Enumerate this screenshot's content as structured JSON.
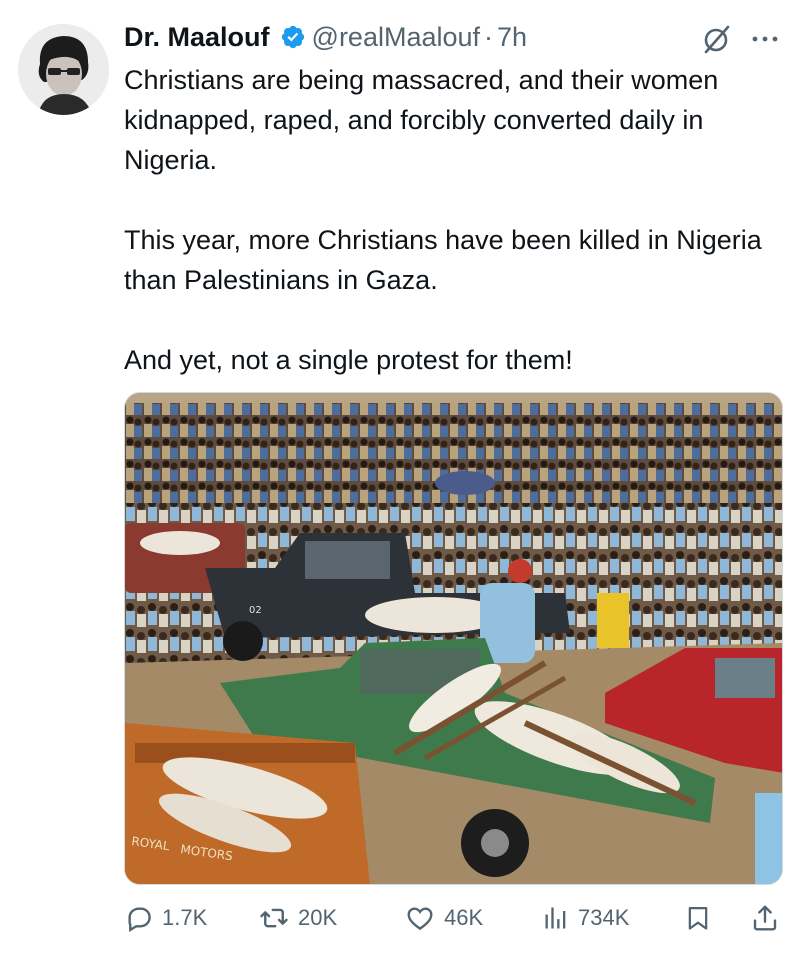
{
  "author": {
    "name": "Dr. Maalouf",
    "handle": "@realMaalouf",
    "separator": "·",
    "time": "7h"
  },
  "icons": {
    "verified": "verified-badge-icon",
    "grok": "grok-icon",
    "more": "more-options-icon"
  },
  "colors": {
    "verified": "#1d9bf0",
    "muted": "#536471",
    "text": "#0f1419"
  },
  "tweet": {
    "paragraphs": [
      "Christians are being massacred, and their women kidnapped, raped, and forcibly converted daily in Nigeria.",
      "This year, more Christians have been killed in Nigeria than Palestinians in Gaza.",
      "And yet, not a single protest for them!"
    ]
  },
  "media": {
    "vehicle_texts": [
      "02",
      "ROYAL",
      "MOTORS"
    ]
  },
  "actions": {
    "replies": "1.7K",
    "reposts": "20K",
    "likes": "46K",
    "views": "734K"
  }
}
